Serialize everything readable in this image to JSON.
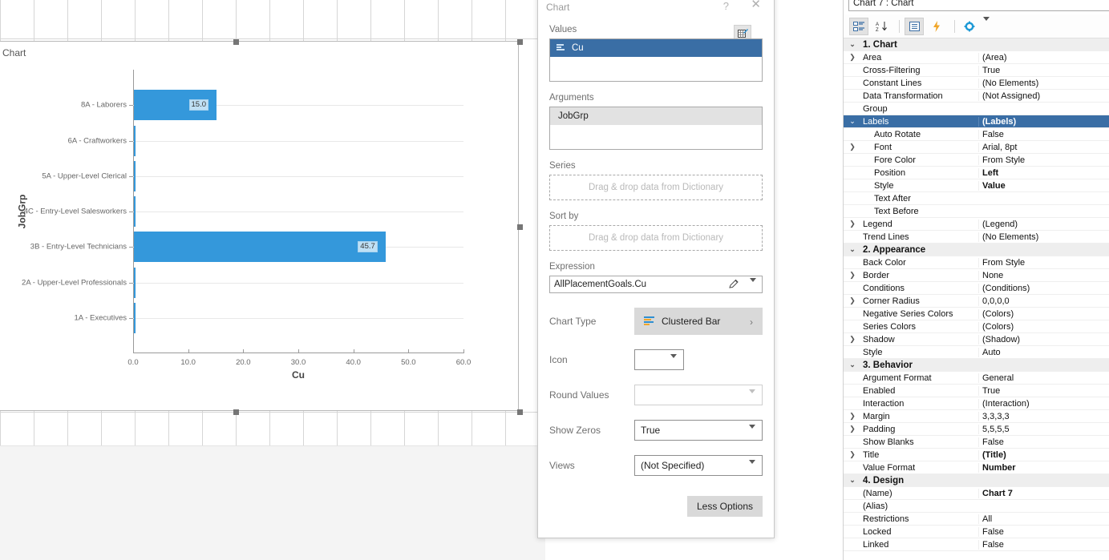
{
  "canvas": {
    "chart_object_label": "Chart",
    "selection_handles": 8
  },
  "chart_data": {
    "type": "bar",
    "orientation": "horizontal",
    "title": "",
    "xlabel": "Cu",
    "ylabel": "JobGrp",
    "xlim": [
      0,
      60
    ],
    "xticks": [
      "0.0",
      "10.0",
      "20.0",
      "30.0",
      "40.0",
      "50.0",
      "60.0"
    ],
    "grid": true,
    "legend": false,
    "bar_color": "#3498db",
    "label_bg_color": "#bfe0f5",
    "categories": [
      "8A - Laborers",
      "6A - Craftworkers",
      "5A - Upper-Level Clerical",
      "4C - Entry-Level Salesworkers",
      "3B - Entry-Level Technicians",
      "2A - Upper-Level Professionals",
      "1A - Executives"
    ],
    "values": [
      15.0,
      0.0,
      0.0,
      0.0,
      45.7,
      0.0,
      0.0
    ],
    "data_labels": [
      "15.0",
      "",
      "",
      "",
      "45.7",
      "",
      ""
    ]
  },
  "dialog": {
    "title": "Chart",
    "help_label": "?",
    "close_label": "✕",
    "grid_button_icon": "grid-edit-icon",
    "values": {
      "label": "Values",
      "items": [
        {
          "label": "Cu",
          "selected": true,
          "icon": "bar-chart-icon"
        }
      ]
    },
    "arguments": {
      "label": "Arguments",
      "items": [
        {
          "label": "JobGrp",
          "selected": false
        }
      ]
    },
    "series": {
      "label": "Series",
      "placeholder": "Drag & drop data from Dictionary"
    },
    "sort_by": {
      "label": "Sort by",
      "placeholder": "Drag & drop data from Dictionary"
    },
    "expression": {
      "label": "Expression",
      "value": "AllPlacementGoals.Cu"
    },
    "chart_type": {
      "label": "Chart Type",
      "value": "Clustered Bar"
    },
    "icon": {
      "label": "Icon",
      "value": ""
    },
    "round_values": {
      "label": "Round Values",
      "value": ""
    },
    "show_zeros": {
      "label": "Show Zeros",
      "value": "True"
    },
    "views": {
      "label": "Views",
      "value": "(Not Specified)"
    },
    "less_options_label": "Less Options"
  },
  "properties": {
    "combo_value": "Chart 7 : Chart",
    "toolbar": [
      {
        "name": "categorized-view-icon",
        "active": true
      },
      {
        "name": "alphabetical-sort-icon",
        "active": false
      },
      {
        "name": "property-pages-icon",
        "active": true
      },
      {
        "name": "events-icon",
        "active": false
      },
      {
        "name": "settings-gear-icon",
        "active": false
      }
    ],
    "rows": [
      {
        "expand": "v",
        "name": "1. Chart",
        "value": "",
        "cat": true
      },
      {
        "expand": ">",
        "name": "Area",
        "value": "(Area)"
      },
      {
        "expand": "",
        "name": "Cross-Filtering",
        "value": "True"
      },
      {
        "expand": "",
        "name": "Constant Lines",
        "value": "(No Elements)"
      },
      {
        "expand": "",
        "name": "Data Transformation",
        "value": "(Not Assigned)"
      },
      {
        "expand": "",
        "name": "Group",
        "value": ""
      },
      {
        "expand": "v",
        "name": "Labels",
        "value": "(Labels)",
        "selected": true,
        "bold": true
      },
      {
        "expand": "",
        "name": "Auto Rotate",
        "value": "False",
        "indent": 1
      },
      {
        "expand": ">",
        "name": "Font",
        "value": "Arial, 8pt",
        "indent": 1
      },
      {
        "expand": "",
        "name": "Fore Color",
        "value": "From Style",
        "indent": 1
      },
      {
        "expand": "",
        "name": "Position",
        "value": "Left",
        "indent": 1,
        "bold": true
      },
      {
        "expand": "",
        "name": "Style",
        "value": "Value",
        "indent": 1,
        "bold": true
      },
      {
        "expand": "",
        "name": "Text After",
        "value": "",
        "indent": 1
      },
      {
        "expand": "",
        "name": "Text Before",
        "value": "",
        "indent": 1
      },
      {
        "expand": ">",
        "name": "Legend",
        "value": "(Legend)"
      },
      {
        "expand": "",
        "name": "Trend Lines",
        "value": "(No Elements)"
      },
      {
        "expand": "v",
        "name": "2. Appearance",
        "value": "",
        "cat": true
      },
      {
        "expand": "",
        "name": "Back Color",
        "value": "From Style"
      },
      {
        "expand": ">",
        "name": "Border",
        "value": "None"
      },
      {
        "expand": "",
        "name": "Conditions",
        "value": "(Conditions)"
      },
      {
        "expand": ">",
        "name": "Corner Radius",
        "value": "0,0,0,0"
      },
      {
        "expand": "",
        "name": "Negative Series Colors",
        "value": "(Colors)"
      },
      {
        "expand": "",
        "name": "Series Colors",
        "value": "(Colors)"
      },
      {
        "expand": ">",
        "name": "Shadow",
        "value": "(Shadow)"
      },
      {
        "expand": "",
        "name": "Style",
        "value": "Auto"
      },
      {
        "expand": "v",
        "name": "3. Behavior",
        "value": "",
        "cat": true
      },
      {
        "expand": "",
        "name": "Argument Format",
        "value": "General"
      },
      {
        "expand": "",
        "name": "Enabled",
        "value": "True"
      },
      {
        "expand": "",
        "name": "Interaction",
        "value": "(Interaction)"
      },
      {
        "expand": ">",
        "name": "Margin",
        "value": "3,3,3,3"
      },
      {
        "expand": ">",
        "name": "Padding",
        "value": "5,5,5,5"
      },
      {
        "expand": "",
        "name": "Show Blanks",
        "value": "False"
      },
      {
        "expand": ">",
        "name": "Title",
        "value": "(Title)",
        "bold": true
      },
      {
        "expand": "",
        "name": "Value Format",
        "value": "Number",
        "bold": true
      },
      {
        "expand": "v",
        "name": "4. Design",
        "value": "",
        "cat": true
      },
      {
        "expand": "",
        "name": "(Name)",
        "value": "Chart 7",
        "bold": true
      },
      {
        "expand": "",
        "name": "(Alias)",
        "value": ""
      },
      {
        "expand": "",
        "name": "Restrictions",
        "value": "All"
      },
      {
        "expand": "",
        "name": "Locked",
        "value": "False"
      },
      {
        "expand": "",
        "name": "Linked",
        "value": "False"
      }
    ]
  }
}
